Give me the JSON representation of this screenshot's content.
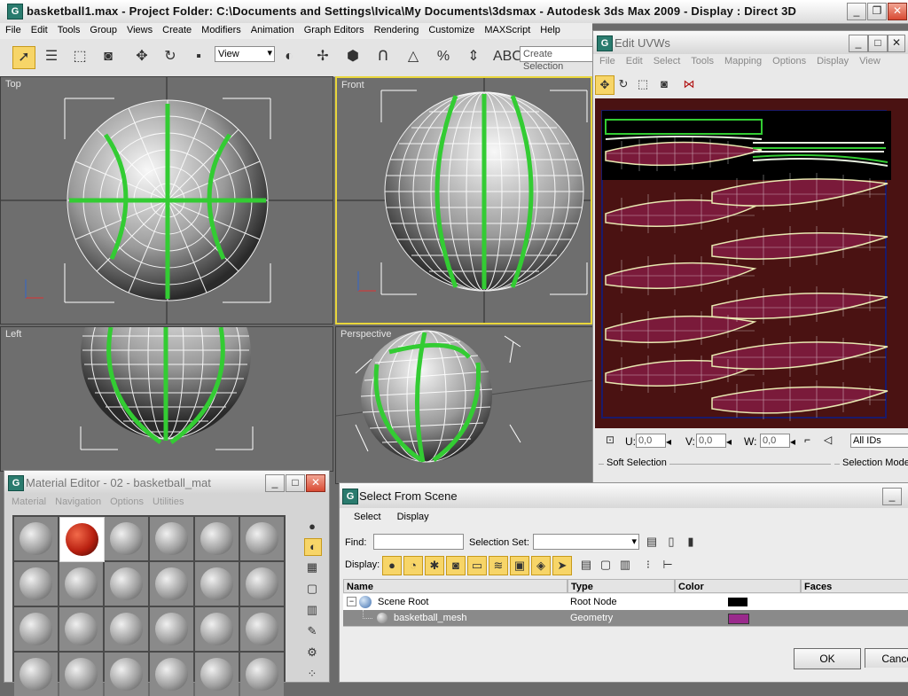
{
  "app": {
    "title": "basketball1.max  - Project Folder: C:\\Documents and Settings\\Ivica\\My Documents\\3dsmax   - Autodesk 3ds Max  2009     - Display : Direct 3D",
    "icon": "G"
  },
  "menu": [
    "File",
    "Edit",
    "Tools",
    "Group",
    "Views",
    "Create",
    "Modifiers",
    "Animation",
    "Graph Editors",
    "Rendering",
    "Customize",
    "MAXScript",
    "Help"
  ],
  "toolbar": {
    "view_select": "View",
    "selection_set_placeholder": "Create Selection"
  },
  "viewports": [
    {
      "label": "Top"
    },
    {
      "label": "Front"
    },
    {
      "label": "Left"
    },
    {
      "label": "Perspective"
    }
  ],
  "uvw": {
    "title": "Edit UVWs",
    "icon": "G",
    "menu": [
      "File",
      "Edit",
      "Select",
      "Tools",
      "Mapping",
      "Options",
      "Display",
      "View"
    ],
    "u_label": "U:",
    "u_value": "0,0",
    "v_label": "V:",
    "v_value": "0,0",
    "w_label": "W:",
    "w_value": "0,0",
    "ids_value": "All IDs",
    "soft_selection": "Soft Selection",
    "selection_modes": "Selection Mode"
  },
  "material_editor": {
    "title": "Material Editor - 02 - basketball_mat",
    "icon": "G",
    "menu": [
      "Material",
      "Navigation",
      "Options",
      "Utilities"
    ]
  },
  "select_from_scene": {
    "title": "Select From Scene",
    "icon": "G",
    "menu": [
      "Select",
      "Display"
    ],
    "find_label": "Find:",
    "find_value": "",
    "selection_set_label": "Selection Set:",
    "display_label": "Display:",
    "columns": [
      "Name",
      "Type",
      "Color",
      "Faces"
    ],
    "rows": [
      {
        "name": "Scene Root",
        "type": "Root Node",
        "color": "#000000"
      },
      {
        "name": "basketball_mesh",
        "type": "Geometry",
        "color": "#9a2a8c"
      }
    ],
    "ok_label": "OK",
    "cancel_label": "Cancel"
  },
  "colors": {
    "wire": "#ffffff",
    "seam": "#33cc33",
    "active_border": "#e9d63c",
    "uv_bg": "#4a1212",
    "uv_island": "#7a1a3a"
  }
}
